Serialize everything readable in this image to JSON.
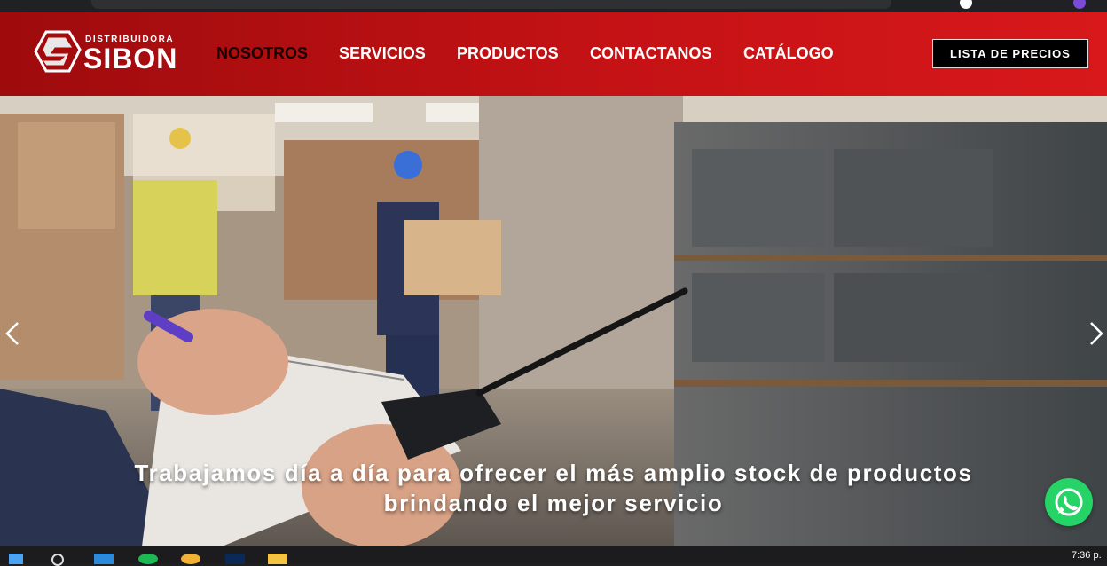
{
  "brand": {
    "small_text": "DISTRIBUIDORA",
    "name": "SIBON",
    "color": "#c41215"
  },
  "nav": {
    "items": [
      {
        "label": "NOSOTROS",
        "active": true
      },
      {
        "label": "SERVICIOS",
        "active": false
      },
      {
        "label": "PRODUCTOS",
        "active": false
      },
      {
        "label": "CONTACTANOS",
        "active": false
      },
      {
        "label": "CATÁLOGO",
        "active": false
      }
    ],
    "cta_label": "LISTA DE PRECIOS"
  },
  "hero": {
    "caption_line1": "Trabajamos día a día para ofrecer el más amplio stock de productos",
    "caption_line2": "brindando el mejor servicio",
    "prev_icon": "chevron-left-icon",
    "next_icon": "chevron-right-icon"
  },
  "floating": {
    "whatsapp_icon": "whatsapp-icon",
    "whatsapp_color": "#25d366"
  },
  "taskbar": {
    "clock": "7:36 p."
  }
}
